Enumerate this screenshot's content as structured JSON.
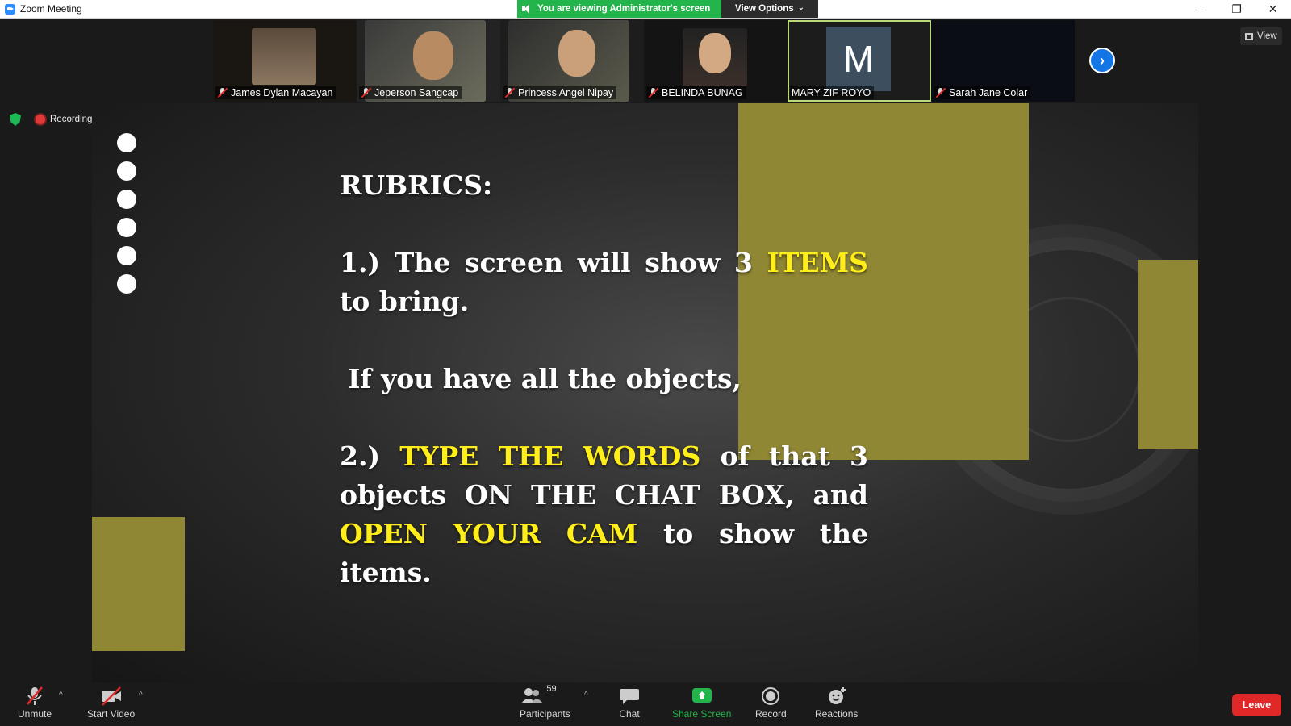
{
  "window": {
    "title": "Zoom Meeting",
    "controls": {
      "minimize": "—",
      "restore": "❐",
      "close": "✕"
    }
  },
  "banner": {
    "viewing_text": "You are viewing Administrator's screen",
    "view_options_label": "View Options",
    "view_options_caret": "⌄"
  },
  "gallery": {
    "participants": [
      {
        "name": "James Dylan Macayan",
        "muted": true
      },
      {
        "name": "Jeperson Sangcap",
        "muted": true
      },
      {
        "name": "Princess Angel Nipay",
        "muted": true
      },
      {
        "name": "BELINDA BUNAG",
        "muted": true
      },
      {
        "name": "MARY ZIF ROYO",
        "muted": false,
        "avatar_letter": "M"
      },
      {
        "name": "Sarah Jane Colar",
        "muted": true
      }
    ],
    "next_icon": "›",
    "view_label": "View"
  },
  "status": {
    "recording_label": "Recording"
  },
  "slide": {
    "title": "RUBRICS:",
    "item1_prefix": "1.) The screen will show 3",
    "item1_highlight": "ITEMS",
    "item1_suffix": "to bring.",
    "condition": "If you have all the objects,",
    "item2_prefix": "2.)",
    "item2_highlight1": "TYPE THE WORDS",
    "item2_mid": "of that 3 objects ON THE CHAT BOX, and",
    "item2_highlight2": "OPEN YOUR CAM",
    "item2_suffix": "to show the items."
  },
  "toolbar": {
    "unmute_label": "Unmute",
    "start_video_label": "Start Video",
    "participants_label": "Participants",
    "participants_count": "59",
    "chat_label": "Chat",
    "share_screen_label": "Share Screen",
    "record_label": "Record",
    "reactions_label": "Reactions",
    "leave_label": "Leave",
    "caret": "^"
  },
  "colors": {
    "share_green": "#23B44B",
    "accent_blue": "#2D8CFF",
    "leave_red": "#E02828",
    "slide_yellow": "#FFEE1A",
    "deco_olive": "#8F8734"
  }
}
